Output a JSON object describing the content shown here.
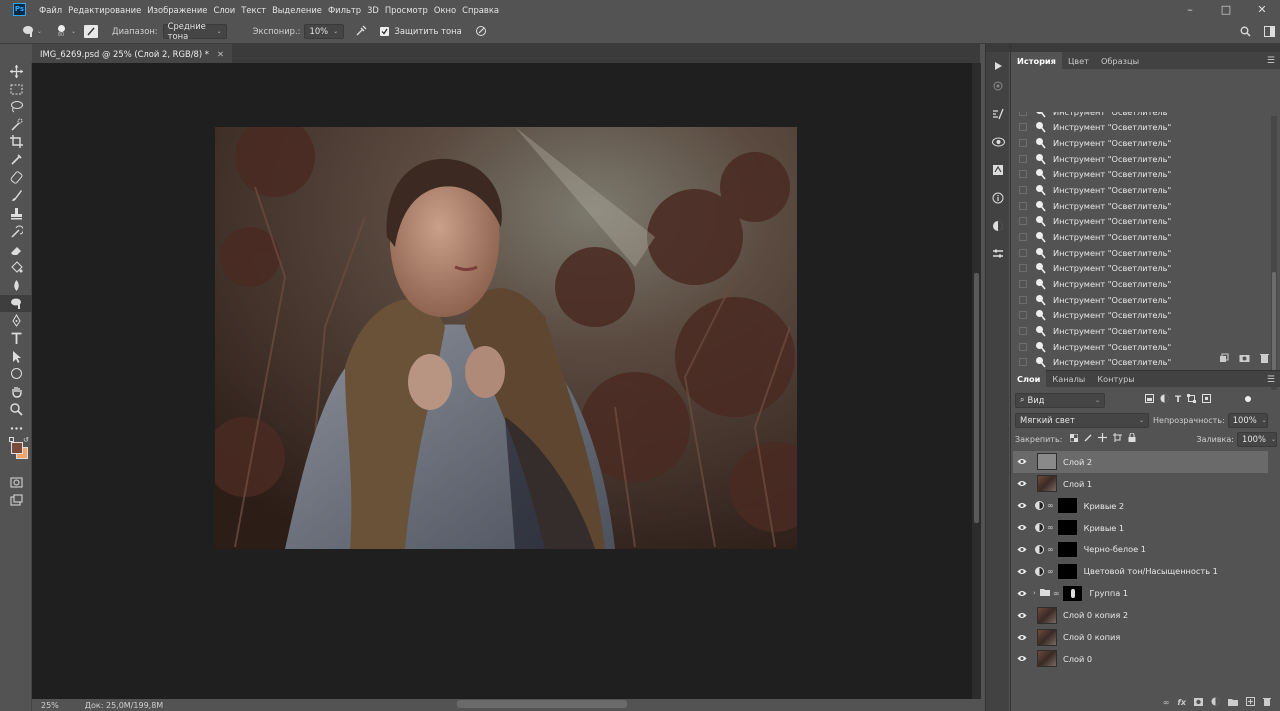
{
  "app": {
    "logo": "Ps"
  },
  "menu": [
    "Файл",
    "Редактирование",
    "Изображение",
    "Слои",
    "Текст",
    "Выделение",
    "Фильтр",
    "3D",
    "Просмотр",
    "Окно",
    "Справка"
  ],
  "options": {
    "brush_size": "80",
    "range_label": "Диапазон:",
    "range_value": "Средние тона",
    "exposure_label": "Экспонир.:",
    "exposure_value": "10%",
    "protect_tones_label": "Защитить тона",
    "protect_tones_checked": true
  },
  "document": {
    "tab_title": "IMG_6269.psd @ 25% (Слой 2, RGB/8) *",
    "zoom": "25%",
    "doc_size": "Док: 25,0M/199,8M"
  },
  "history_panel": {
    "tabs": [
      "История",
      "Цвет",
      "Образцы"
    ],
    "items": [
      "Инструмент \"Осветлитель\"",
      "Инструмент \"Осветлитель\"",
      "Инструмент \"Осветлитель\"",
      "Инструмент \"Осветлитель\"",
      "Инструмент \"Осветлитель\"",
      "Инструмент \"Осветлитель\"",
      "Инструмент \"Осветлитель\"",
      "Инструмент \"Осветлитель\"",
      "Инструмент \"Осветлитель\"",
      "Инструмент \"Осветлитель\"",
      "Инструмент \"Осветлитель\"",
      "Инструмент \"Осветлитель\"",
      "Инструмент \"Осветлитель\"",
      "Инструмент \"Осветлитель\"",
      "Инструмент \"Осветлитель\"",
      "Инструмент \"Осветлитель\"",
      "Инструмент \"Осветлитель\"",
      "Инструмент \"Осветлитель\""
    ]
  },
  "layers_panel": {
    "tabs": [
      "Слои",
      "Каналы",
      "Контуры"
    ],
    "filter_label": "Вид",
    "blend_mode": "Мягкий свет",
    "opacity_label": "Непрозрачность:",
    "opacity_value": "100%",
    "lock_label": "Закрепить:",
    "fill_label": "Заливка:",
    "fill_value": "100%",
    "layers": [
      {
        "name": "Слой 2",
        "kind": "plain"
      },
      {
        "name": "Слой 1",
        "kind": "photo"
      },
      {
        "name": "Кривые 2",
        "kind": "adjust"
      },
      {
        "name": "Кривые 1",
        "kind": "adjust"
      },
      {
        "name": "Черно-белое 1",
        "kind": "adjust"
      },
      {
        "name": "Цветовой тон/Насыщенность 1",
        "kind": "adjust"
      },
      {
        "name": "Группа 1",
        "kind": "group"
      },
      {
        "name": "Слой 0 копия 2",
        "kind": "photo"
      },
      {
        "name": "Слой 0 копия",
        "kind": "photo"
      },
      {
        "name": "Слой 0",
        "kind": "photo"
      }
    ]
  },
  "colors": {
    "foreground": "#7a4a3c",
    "background": "#f2a46a",
    "accent": "#31a8ff"
  }
}
